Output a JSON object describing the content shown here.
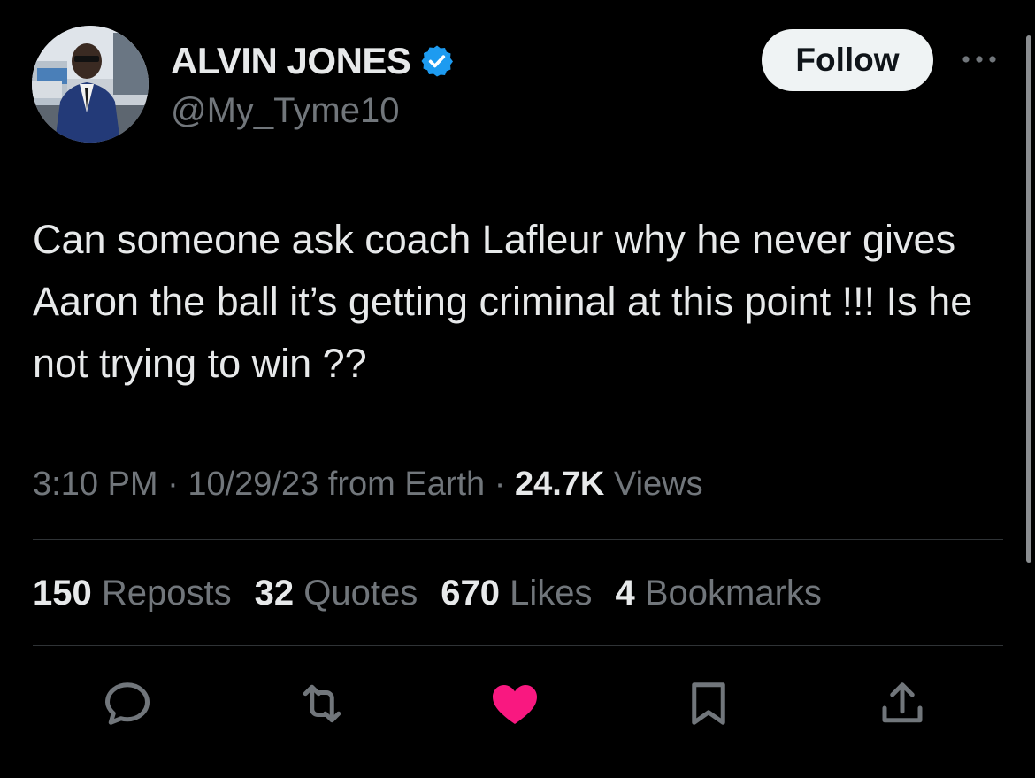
{
  "tweet": {
    "author": {
      "display_name": "ALVIN JONES",
      "handle": "@My_Tyme10",
      "verified_icon": "verified-badge-icon"
    },
    "follow_label": "Follow",
    "more_icon": "more-options-icon",
    "text": "Can someone ask coach Lafleur why he never gives Aaron the ball it’s getting criminal at this point !!! Is he not trying to win ??",
    "time": "3:10 PM",
    "date": "10/29/23",
    "source": "from Earth",
    "separator": "·",
    "views_count": "24.7K",
    "views_label": "Views"
  },
  "stats": {
    "reposts": {
      "count": "150",
      "label": "Reposts"
    },
    "quotes": {
      "count": "32",
      "label": "Quotes"
    },
    "likes": {
      "count": "670",
      "label": "Likes"
    },
    "bookmarks": {
      "count": "4",
      "label": "Bookmarks"
    }
  },
  "actions": [
    "reply-icon",
    "repost-icon",
    "like-icon",
    "bookmark-icon",
    "share-icon"
  ],
  "colors": {
    "background": "#000000",
    "text": "#e7e9ea",
    "muted": "#71767b",
    "verified": "#1d9bf0",
    "like": "#f91880",
    "divider": "#2f3336"
  }
}
